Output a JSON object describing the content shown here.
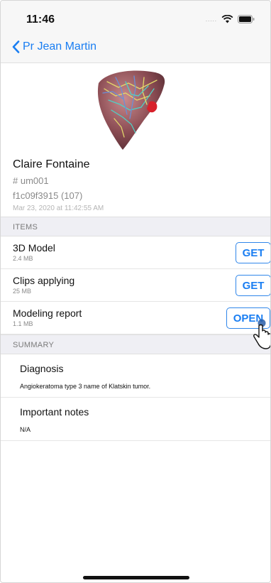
{
  "status_bar": {
    "time": "11:46",
    "signal_dots": "....."
  },
  "nav": {
    "back_label": "Pr Jean Martin"
  },
  "patient": {
    "name": "Claire Fontaine",
    "id": "# um001",
    "hash": "f1c09f3915 (107)",
    "date": "Mar 23, 2020 at 11:42:55 AM"
  },
  "sections": {
    "items": "ITEMS",
    "summary": "SUMMARY"
  },
  "items": [
    {
      "title": "3D Model",
      "size": "2.4 MB",
      "button": "GET"
    },
    {
      "title": "Clips applying",
      "size": "25 MB",
      "button": "GET"
    },
    {
      "title": "Modeling report",
      "size": "1.1 MB",
      "button": "OPEN"
    }
  ],
  "summary": [
    {
      "title": "Diagnosis",
      "text": "Angiokeratoma type 3 name of Klatskin tumor."
    },
    {
      "title": "Important notes",
      "text": "N/A"
    }
  ],
  "colors": {
    "accent": "#1a7ef2",
    "section_bg": "#efeff4",
    "muted_text": "#8a8a8a"
  },
  "icons": [
    "back-chevron-icon",
    "wifi-icon",
    "battery-icon",
    "liver-model-thumbnail",
    "pointer-hand-icon"
  ]
}
